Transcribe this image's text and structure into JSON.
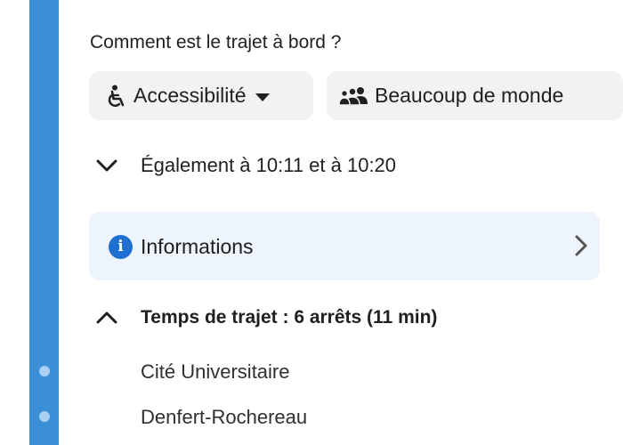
{
  "onboard": {
    "question": "Comment est le trajet à bord ?",
    "accessibility_chip": {
      "label": "Accessibilité",
      "icon": "wheelchair-icon"
    },
    "crowd_chip": {
      "label": "Beaucoup de monde",
      "icon": "people-icon"
    }
  },
  "departures": {
    "label": "Également à 10:11 et à 10:20",
    "icon": "chevron-down-icon"
  },
  "info_card": {
    "label": "Informations",
    "icon": "info-icon",
    "info_glyph": "i"
  },
  "travel": {
    "label": "Temps de trajet : 6 arrêts (11 min)",
    "icon": "chevron-up-icon"
  },
  "stops": [
    {
      "name": "Cité Universitaire"
    },
    {
      "name": "Denfert-Rochereau"
    }
  ],
  "colors": {
    "line": "#3b8fd6",
    "stop_dot": "#a9d0f2",
    "info_accent": "#1f6fd1",
    "info_card_bg": "#eef4fb",
    "chip_bg": "#f1f2f4"
  }
}
